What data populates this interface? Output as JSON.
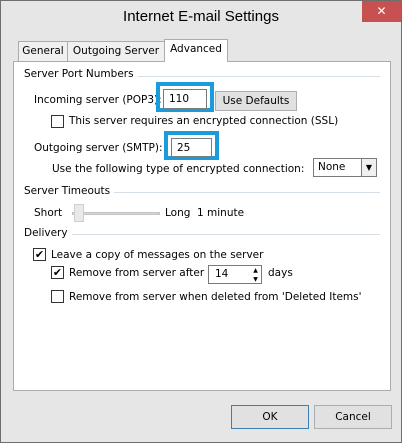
{
  "window": {
    "title": "Internet E-mail Settings",
    "close_glyph": "✕"
  },
  "tabs": [
    "General",
    "Outgoing Server",
    "Advanced"
  ],
  "server_ports": {
    "section_label": "Server Port Numbers",
    "incoming_label": "Incoming server (POP3):",
    "incoming_value": "110",
    "use_defaults_label": "Use Defaults",
    "ssl_label": "This server requires an encrypted connection (SSL)",
    "ssl_checked": false,
    "outgoing_label": "Outgoing server (SMTP):",
    "outgoing_value": "25",
    "encryption_label": "Use the following type of encrypted connection:",
    "encryption_value": "None"
  },
  "timeouts": {
    "section_label": "Server Timeouts",
    "short_label": "Short",
    "long_label": "Long",
    "value_label": "1 minute",
    "slider_level": 0.05
  },
  "delivery": {
    "section_label": "Delivery",
    "leave_copy_label": "Leave a copy of messages on the server",
    "leave_copy_checked": true,
    "remove_after_label": "Remove from server after",
    "remove_after_checked": true,
    "days_value": "14",
    "days_label": "days",
    "remove_deleted_label": "Remove from server when deleted from 'Deleted Items'",
    "remove_deleted_checked": false
  },
  "buttons": {
    "ok": "OK",
    "cancel": "Cancel"
  },
  "colors": {
    "highlight": "#1a9bdc",
    "close": "#c75050",
    "panel_bg": "#ffffff",
    "window_bg": "#e6e6e6"
  },
  "check_glyph": "✔",
  "icons": {
    "spin_up": "▲",
    "spin_down": "▼",
    "dropdown": "▼"
  }
}
